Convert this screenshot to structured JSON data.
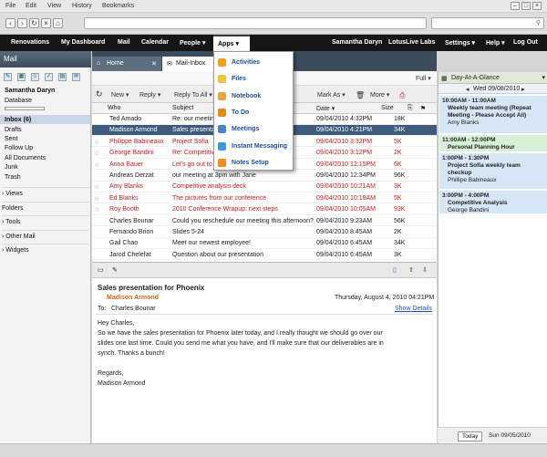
{
  "browser": {
    "menu": [
      "File",
      "Edit",
      "View",
      "History",
      "Bookmarks"
    ],
    "window_buttons": [
      "–",
      "□",
      "×"
    ]
  },
  "topnav": {
    "left": [
      "Renovations",
      "My Dashboard",
      "Mail",
      "Calendar",
      "People ▾"
    ],
    "active": "Apps ▾",
    "right": [
      "Samantha Daryn",
      "LotusLive Labs",
      "Settings ▾",
      "Help ▾",
      "Log Out"
    ]
  },
  "apps_menu": [
    {
      "label": "Activities",
      "color": "#f0a020"
    },
    {
      "label": "Files",
      "color": "#f3c23b"
    },
    {
      "label": "Notebook",
      "color": "#e9a53b"
    },
    {
      "label": "To Do",
      "color": "#e58a21"
    },
    {
      "label": "Meetings",
      "color": "#4a86c9"
    },
    {
      "label": "Instant Messaging",
      "color": "#3c9ad6"
    },
    {
      "label": "Notes Setup",
      "color": "#f28c1f"
    }
  ],
  "sidebar": {
    "title": "Mail",
    "user": "Samantha Daryn",
    "subtitle": "Database",
    "folders": [
      "Inbox (6)",
      "Drafts",
      "Sent",
      "Follow Up",
      "All Documents",
      "Junk",
      "Trash"
    ],
    "sections": [
      "Views",
      "Folders",
      "Tools",
      "Other Mail",
      "Widgets"
    ]
  },
  "tabs": {
    "home": "Home",
    "inbox": "Mail-Inbox"
  },
  "list_toolbar": {
    "new": "New ▾",
    "reply": "Reply ▾",
    "reply_all": "Reply To All ▾",
    "mark_as": "Mark As ▾",
    "more": "More ▾",
    "view": "Full ▾"
  },
  "columns": {
    "who": "Who",
    "subject": "Subject",
    "date": "Date ▾",
    "size": "Size"
  },
  "mails": [
    {
      "who": "Ted Amado",
      "subject": "Re: our meeting",
      "date": "09/04/2010 4:32PM",
      "size": "18K",
      "style": ""
    },
    {
      "who": "Madison Armond",
      "subject": "Sales presentation",
      "date": "09/04/2010 4:21PM",
      "size": "34K",
      "style": "sel"
    },
    {
      "who": "Philippe Babineaux",
      "subject": "Project Sofia",
      "date": "09/04/2010 3:32PM",
      "size": "5K",
      "style": "red"
    },
    {
      "who": "George Bandini",
      "subject": "Re: Competitive",
      "date": "09/04/2010 3:12PM",
      "size": "2K",
      "style": "red"
    },
    {
      "who": "Anna Bauer",
      "subject": "Let's go out to",
      "date": "09/04/2010 12:15PM",
      "size": "6K",
      "style": "red"
    },
    {
      "who": "Andreas Derzat",
      "subject": "our meeting at 3pm with Jane",
      "date": "09/04/2010 12:34PM",
      "size": "96K",
      "style": ""
    },
    {
      "who": "Amy Blanks",
      "subject": "Competitive analysis deck",
      "date": "09/04/2010 10:21AM",
      "size": "3K",
      "style": "red"
    },
    {
      "who": "Ed Blanks",
      "subject": "The pictures from our conference",
      "date": "09/04/2010 10:18AM",
      "size": "5K",
      "style": "red"
    },
    {
      "who": "Roy Booth",
      "subject": "2010 Conference Wrapup: next steps",
      "date": "09/04/2010 10:05AM",
      "size": "93K",
      "style": "red"
    },
    {
      "who": "Charles Bounar",
      "subject": "Could you reschedule our meeting this afternoon?",
      "date": "09/04/2010 9:23AM",
      "size": "56K",
      "style": ""
    },
    {
      "who": "Fernando Brion",
      "subject": "Slides 5-24",
      "date": "09/04/2010 8:45AM",
      "size": "2K",
      "style": ""
    },
    {
      "who": "Gail Chao",
      "subject": "Meet our newest employee!",
      "date": "09/04/2010 6:45AM",
      "size": "34K",
      "style": ""
    },
    {
      "who": "Jarod Chelefat",
      "subject": "Question about our presentation",
      "date": "09/04/2010 6:45AM",
      "size": "3K",
      "style": ""
    }
  ],
  "preview": {
    "subject": "Sales presentation for Phoenix",
    "from": "Madison Armond",
    "date": "Thursday, August 4, 2010 04:21PM",
    "to_label": "To:",
    "to": "Charles Bounar",
    "show_details": "Show Details",
    "body": [
      "Hey Charles,",
      "So we have the sales presentation for Phoenix later today, and I really thought we should go over our",
      "slides one last time. Could you send me what you have, and I'll make sure that our deliverables are in",
      "synch. Thanks a bunch!",
      "Regards,",
      "Madison Armond"
    ]
  },
  "calendar": {
    "title": "Day-At-A-Glance",
    "day": "Wed 09/08/2010",
    "events": [
      {
        "time": "10:00AM - 11:00AM",
        "title": "Weekly team meeting (Repeat Meeting - Please Accept All)",
        "person": "Amy Blanks",
        "color": "#d6e6f5"
      },
      {
        "time": "11:00AM - 12:00PM",
        "title": "Personal Planning Hour",
        "person": "",
        "color": "#d8f0d8"
      },
      {
        "time": "1:00PM - 1:30PM",
        "title": "Project Sofia weekly team checkup",
        "person": "Phillipe Babineaux",
        "color": "#d6e6f5"
      },
      {
        "time": "3:00PM - 4:00PM",
        "title": "Competitive Analysis",
        "person": "George Bandini",
        "color": "#d6e6f5"
      }
    ],
    "today_button": "Today",
    "today_date": "Sun 09/05/2010"
  }
}
